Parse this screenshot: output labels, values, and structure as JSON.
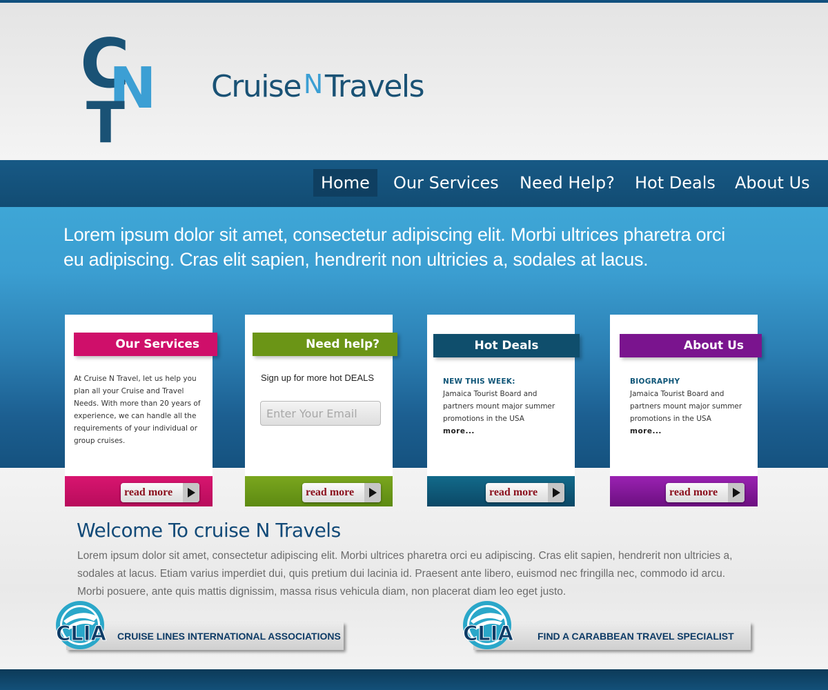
{
  "brand": {
    "name_part1": "Cruise",
    "name_n": "N",
    "name_part2": "Travels",
    "color_dark": "#1a5275",
    "color_light": "#3c9fd4"
  },
  "nav": {
    "items": [
      {
        "label": "Home",
        "active": true
      },
      {
        "label": "Our Services",
        "active": false
      },
      {
        "label": "Need Help?",
        "active": false
      },
      {
        "label": "Hot Deals",
        "active": false
      },
      {
        "label": "About Us",
        "active": false
      }
    ]
  },
  "hero": {
    "text": "Lorem ipsum dolor sit amet, consectetur adipiscing elit. Morbi ultrices pharetra orci eu adipiscing. Cras elit sapien, hendrerit non ultricies a, sodales at lacus."
  },
  "cards": [
    {
      "title": "Our Services",
      "color": "#cf0f6a",
      "body": "At Cruise N Travel, let us help you plan all your Cruise and Travel Needs. With more than 20 years of experience, we can handle all the requirements of your individual or group cruises.",
      "read_more": "read more"
    },
    {
      "title": "Need help?",
      "color": "#6b9516",
      "signup_label": "Sign up for more hot DEALS",
      "email_placeholder": "Enter Your Email",
      "read_more": "read more"
    },
    {
      "title": "Hot Deals",
      "color": "#0f4e6c",
      "heading": "NEW THIS WEEK:",
      "body": "Jamaica Tourist Board and partners mount major summer promotions in the USA",
      "more": "more...",
      "read_more": "read more"
    },
    {
      "title": "About Us",
      "color": "#7a148e",
      "heading": "BIOGRAPHY",
      "body": "Jamaica Tourist Board and partners mount major summer promotions in the USA",
      "more": "more...",
      "read_more": "read more"
    }
  ],
  "welcome": {
    "title": "Welcome To cruise N Travels",
    "text": "Lorem ipsum dolor sit amet, consectetur adipiscing elit. Morbi ultrices pharetra orci eu adipiscing. Cras elit sapien, hendrerit non ultricies a, sodales at lacus. Etiam varius imperdiet dui, quis pretium dui lacinia id. Praesent ante libero, euismod nec fringilla nec, commodo id arcu. Morbi posuere, ante quis mattis dignissim, massa risus vehicula diam, non placerat diam leo eget justo."
  },
  "banners": [
    {
      "logo_text": "CLIA",
      "label": "CRUISE LINES INTERNATIONAL ASSOCIATIONS"
    },
    {
      "logo_text": "CLIA",
      "label": "FIND A CARABBEAN TRAVEL SPECIALIST"
    }
  ]
}
